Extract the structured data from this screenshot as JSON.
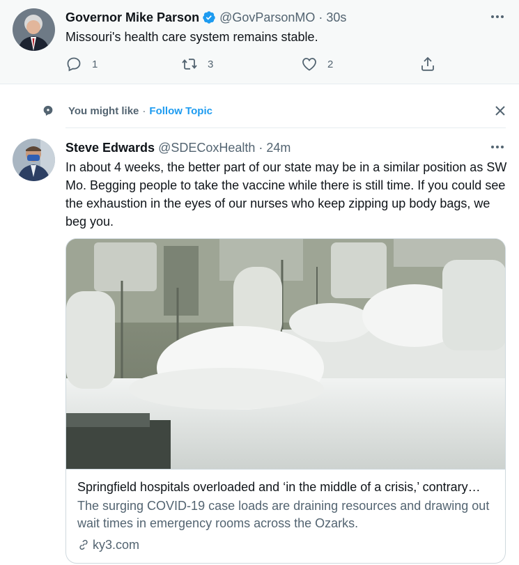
{
  "tweet1": {
    "name": "Governor Mike Parson",
    "handle": "@GovParsonMO",
    "time": "· 30s",
    "text": "Missouri's health care system remains stable.",
    "reply_count": "1",
    "retweet_count": "3",
    "like_count": "2"
  },
  "topic": {
    "label": "You might like",
    "dot": "·",
    "follow": "Follow Topic"
  },
  "tweet2": {
    "name": "Steve Edwards",
    "handle": "@SDECoxHealth",
    "time": "· 24m",
    "text": "In about 4 weeks, the better part of our state may be in a similar position as SW Mo. Begging people to take the vaccine while there is still time.  If you could see the exhaustion in the eyes of our nurses who keep zipping up body bags, we beg you."
  },
  "card": {
    "title": "Springfield hospitals overloaded and ‘in the middle of a crisis,’ contrary…",
    "description": "The surging COVID-19 case loads are draining resources and drawing out wait times in emergency rooms across the Ozarks.",
    "domain": "ky3.com"
  },
  "colors": {
    "accent": "#1d9bf0",
    "muted": "#536471",
    "text": "#0f1419"
  }
}
